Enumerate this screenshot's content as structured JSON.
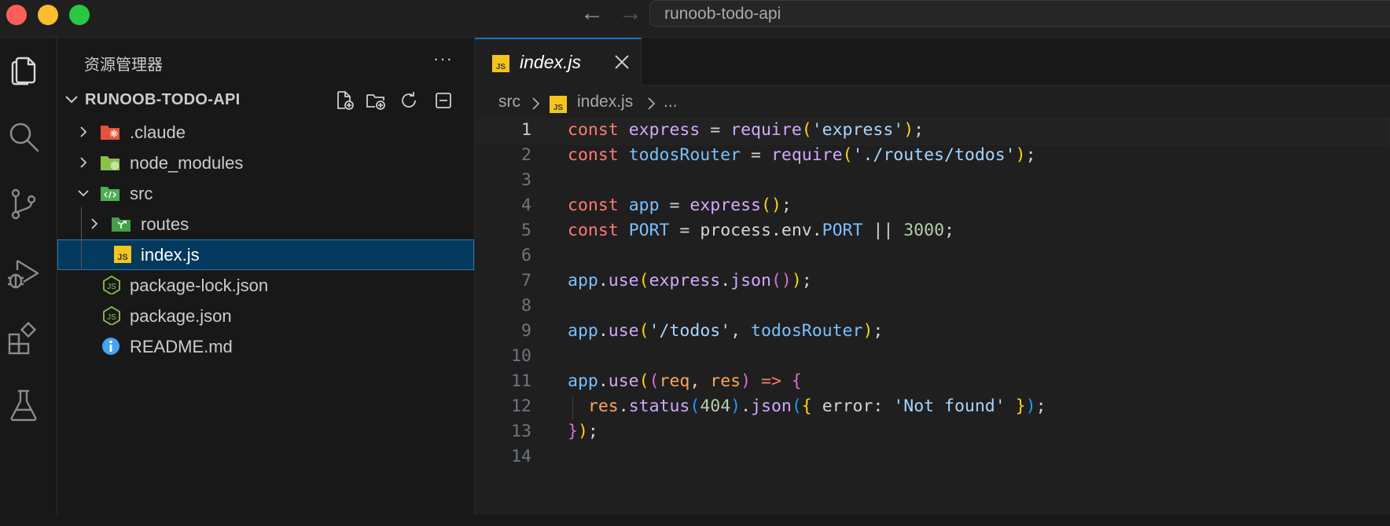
{
  "window": {
    "search_label": "runoob-todo-api"
  },
  "activity_bar": {
    "items": [
      "explorer-icon",
      "search-icon",
      "source-control-icon",
      "run-debug-icon",
      "extensions-icon",
      "testing-icon"
    ]
  },
  "sidebar": {
    "title": "资源管理器",
    "more": "···",
    "section_label": "RUNOOB-TODO-API",
    "tree": [
      {
        "name": ".claude",
        "type": "folder",
        "expanded": false,
        "icon": "claude-folder-icon"
      },
      {
        "name": "node_modules",
        "type": "folder",
        "expanded": false,
        "icon": "node-folder-icon"
      },
      {
        "name": "src",
        "type": "folder",
        "expanded": true,
        "icon": "src-folder-icon"
      },
      {
        "name": "routes",
        "type": "folder",
        "expanded": false,
        "icon": "routes-folder-icon"
      },
      {
        "name": "index.js",
        "type": "file",
        "selected": true,
        "icon": "js-file-icon"
      },
      {
        "name": "package-lock.json",
        "type": "file",
        "icon": "node-json-icon"
      },
      {
        "name": "package.json",
        "type": "file",
        "icon": "node-json-icon"
      },
      {
        "name": "README.md",
        "type": "file",
        "icon": "info-icon"
      }
    ]
  },
  "editor": {
    "tab_label": "index.js",
    "tab_badge": "JS",
    "breadcrumb": {
      "folder": "src",
      "file": "index.js",
      "more": "..."
    },
    "current_line": 1,
    "line_numbers": [
      "1",
      "2",
      "3",
      "4",
      "5",
      "6",
      "7",
      "8",
      "9",
      "10",
      "11",
      "12",
      "13",
      "14"
    ],
    "code": [
      "const express = require('express');",
      "const todosRouter = require('./routes/todos');",
      "",
      "const app = express();",
      "const PORT = process.env.PORT || 3000;",
      "",
      "app.use(express.json());",
      "",
      "app.use('/todos', todosRouter);",
      "",
      "app.use((req, res) => {",
      "  res.status(404).json({ error: 'Not found' });",
      "});",
      ""
    ]
  },
  "colors": {
    "accent": "#0078d4",
    "selection": "#04395e",
    "keyword": "#ff7b72",
    "variable": "#79c0ff",
    "function": "#d2a8ff",
    "string": "#a5d6ff"
  }
}
